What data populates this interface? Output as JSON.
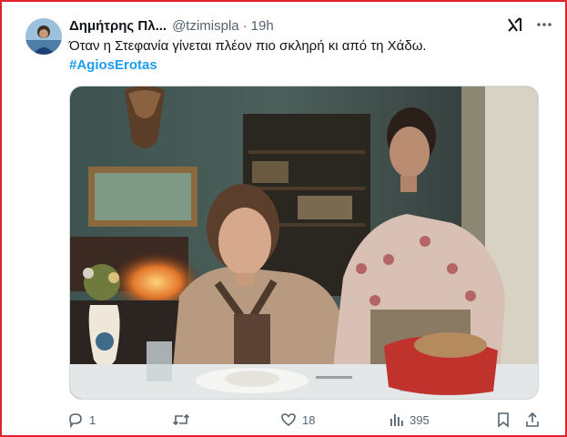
{
  "tweet": {
    "author_name": "Δημήτρης Πλ...",
    "handle": "@tzimispla",
    "separator": "·",
    "time": "19h",
    "text": "Όταν η Στεφανία γίνεται πλέον πιο σκληρή κι από τη Χάδω.",
    "hashtag": "#AgiosErotas"
  },
  "toolbar": {
    "grok_icon": "grok-icon",
    "more_icon": "more-icon"
  },
  "actions": {
    "replies": "1",
    "reposts": "",
    "likes": "18",
    "views": "395"
  },
  "colors": {
    "border": "#e0242b",
    "link": "#1d9bf0",
    "muted": "#536471"
  }
}
